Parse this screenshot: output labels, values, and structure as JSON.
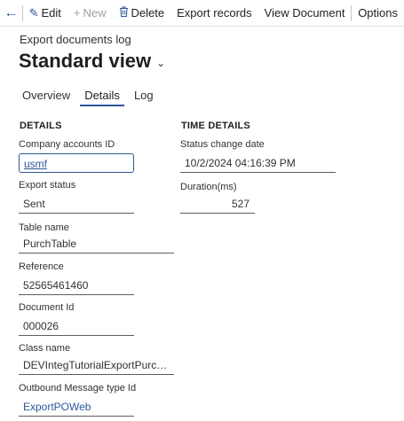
{
  "toolbar": {
    "edit_label": "Edit",
    "new_label": "New",
    "delete_label": "Delete",
    "export_label": "Export records",
    "view_label": "View Document",
    "options_label": "Options"
  },
  "header": {
    "caption": "Export documents log",
    "view_title": "Standard view"
  },
  "tabs": [
    {
      "label": "Overview",
      "active": false
    },
    {
      "label": "Details",
      "active": true
    },
    {
      "label": "Log",
      "active": false
    }
  ],
  "details": {
    "heading": "DETAILS",
    "company_label": "Company accounts ID",
    "company_value": "usmf",
    "status_label": "Export status",
    "status_value": "Sent",
    "table_label": "Table name",
    "table_value": "PurchTable",
    "reference_label": "Reference",
    "reference_value": "52565461460",
    "document_label": "Document Id",
    "document_value": "000026",
    "class_label": "Class name",
    "class_value": "DEVIntegTutorialExportPurch...",
    "outbound_label": "Outbound Message type Id",
    "outbound_value": "ExportPOWeb"
  },
  "time_details": {
    "heading": "TIME DETAILS",
    "status_change_label": "Status change date",
    "status_change_value": "10/2/2024 04:16:39 PM",
    "duration_label": "Duration(ms)",
    "duration_value": "527"
  },
  "colors": {
    "accent": "#2b579a"
  }
}
